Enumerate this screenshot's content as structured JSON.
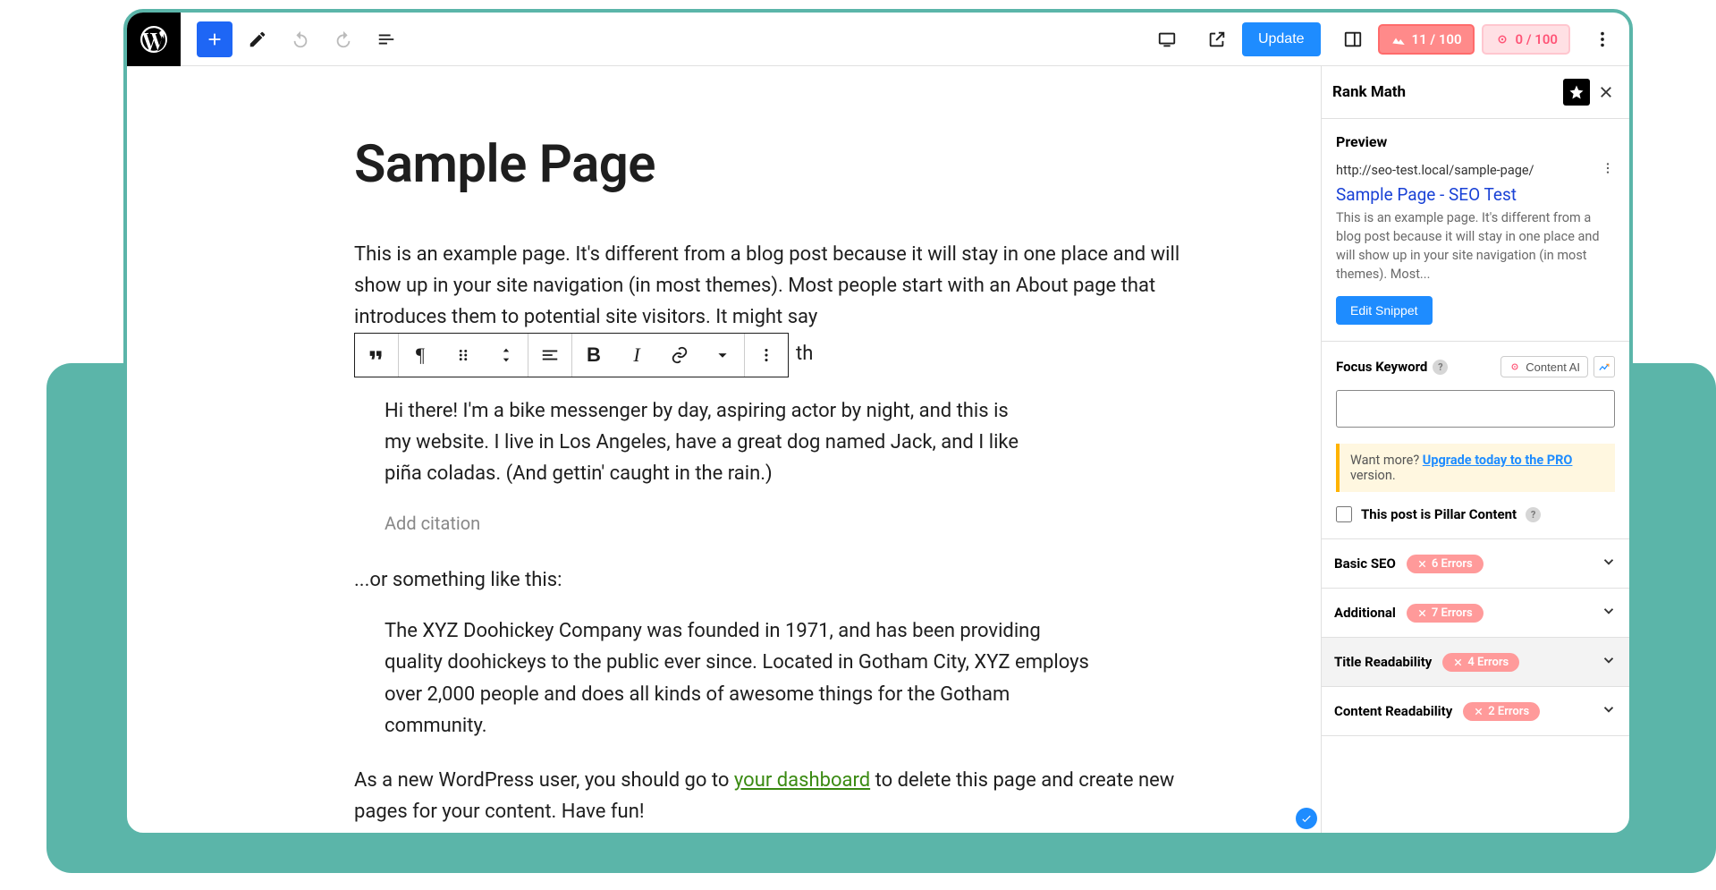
{
  "toolbar": {
    "update_label": "Update",
    "score1": "11 / 100",
    "score2": "0 / 100"
  },
  "editor": {
    "title": "Sample Page",
    "para1": "This is an example page. It's different from a blog post because it will stay in one place and will show up in your site navigation (in most themes). Most people start with an About page that introduces them to potential site visitors. It might say",
    "say_trail": "th",
    "quote1": "Hi there! I'm a bike messenger by day, aspiring actor by night, and this is my website. I live in Los Angeles, have a great dog named Jack, and I like piña coladas. (And gettin' caught in the rain.)",
    "citation_placeholder": "Add citation",
    "para2": "...or something like this:",
    "quote2": "The XYZ Doohickey Company was founded in 1971, and has been providing quality doohickeys to the public ever since. Located in Gotham City, XYZ employs over 2,000 people and does all kinds of awesome things for the Gotham community.",
    "para3a": "As a new WordPress user, you should go to ",
    "para3link": "your dashboard",
    "para3b": " to delete this page and create new pages for your content. Have fun!"
  },
  "sidebar": {
    "title": "Rank Math",
    "preview": {
      "heading": "Preview",
      "url": "http://seo-test.local/sample-page/",
      "title": "Sample Page - SEO Test",
      "desc": "This is an example page. It's different from a blog post because it will stay in one place and will show up in your site navigation (in most themes). Most...",
      "btn": "Edit Snippet"
    },
    "focus": {
      "label": "Focus Keyword",
      "cai": "Content AI",
      "promo_pre": "Want more? ",
      "promo_link": "Upgrade today to the PRO",
      "promo_post": " version.",
      "pillar": "This post is Pillar Content"
    },
    "acc": [
      {
        "label": "Basic SEO",
        "err": "6 Errors",
        "shade": false
      },
      {
        "label": "Additional",
        "err": "7 Errors",
        "shade": false
      },
      {
        "label": "Title Readability",
        "err": "4 Errors",
        "shade": true
      },
      {
        "label": "Content Readability",
        "err": "2 Errors",
        "shade": false
      }
    ]
  }
}
